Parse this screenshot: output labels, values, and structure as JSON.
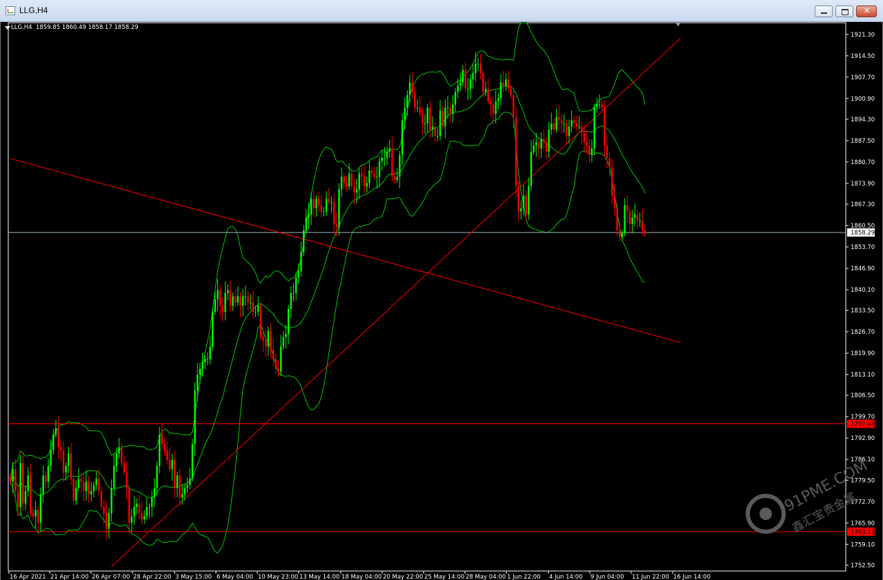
{
  "window": {
    "title": "LLG,H4"
  },
  "chart_header": {
    "symbol": "LLG,H4",
    "ohlc": "1859.85 1860.49 1858.17 1858.29"
  },
  "watermark": {
    "url": "91PME.COM",
    "brand": "鑫汇宝贵金属"
  },
  "colors": {
    "background": "#000000",
    "bull": "#00ff00",
    "bear": "#ff0000",
    "bands": "#00c800",
    "trendline": "#ff0000",
    "price_line": "#9fb6c6",
    "axis_text": "#ffffff",
    "marker_price_bg": "#ff0000"
  },
  "chart_data": {
    "type": "candlestick",
    "symbol": "LLG",
    "timeframe": "H4",
    "ylim": [
      1750.6,
      1925.0
    ],
    "y_ticks": [
      "1921.30",
      "1914.50",
      "1907.70",
      "1900.90",
      "1894.30",
      "1887.50",
      "1880.70",
      "1873.90",
      "1867.30",
      "1860.50",
      "1853.70",
      "1846.90",
      "1840.10",
      "1833.50",
      "1826.70",
      "1819.90",
      "1813.10",
      "1806.50",
      "1799.70",
      "1792.90",
      "1786.10",
      "1779.50",
      "1772.70",
      "1765.90",
      "1759.10",
      "1752.50"
    ],
    "x_ticks": [
      "16 Apr 2021",
      "21 Apr 14:00",
      "26 Apr 07:00",
      "28 Apr 22:00",
      "3 May 15:00",
      "6 May 04:00",
      "10 May 23:00",
      "13 May 14:00",
      "18 May 04:00",
      "20 May 22:00",
      "25 May 14:00",
      "28 May 04:00",
      "1 Jun 22:00",
      "4 Jun 14:00",
      "9 Jun 04:00",
      "11 Jun 22:00",
      "16 Jun 14:00"
    ],
    "current_price": "1858.29",
    "horizontal_levels": [
      "1797.44",
      "1763.13"
    ],
    "trendlines": [
      {
        "from": {
          "bar": 0,
          "price": 1881.8
        },
        "to": {
          "bar": 265,
          "price": 1823.3
        }
      },
      {
        "from": {
          "bar": 40,
          "price": 1752.0
        },
        "to": {
          "bar": 265,
          "price": 1920.0
        }
      }
    ],
    "series": {
      "close": [
        1779,
        1783,
        1776,
        1771,
        1785,
        1772,
        1776,
        1781,
        1769,
        1768,
        1770,
        1766,
        1775,
        1781,
        1779,
        1784,
        1789,
        1794,
        1796,
        1790,
        1789,
        1782,
        1784,
        1788,
        1780,
        1773,
        1777,
        1780,
        1779,
        1776,
        1779,
        1775,
        1776,
        1778,
        1780,
        1776,
        1771,
        1769,
        1764,
        1769,
        1777,
        1784,
        1788,
        1790,
        1785,
        1782,
        1777,
        1766,
        1768,
        1771,
        1772,
        1769,
        1767,
        1768,
        1771,
        1771,
        1774,
        1777,
        1784,
        1794,
        1791,
        1789,
        1786,
        1783,
        1786,
        1777,
        1781,
        1774,
        1775,
        1777,
        1778,
        1780,
        1791,
        1808,
        1813,
        1815,
        1817,
        1818,
        1818,
        1822,
        1833,
        1837,
        1840,
        1835,
        1833,
        1839,
        1840,
        1835,
        1838,
        1836,
        1838,
        1835,
        1838,
        1838,
        1836,
        1836,
        1833,
        1833,
        1835,
        1825,
        1824,
        1822,
        1827,
        1821,
        1818,
        1815,
        1814,
        1822,
        1825,
        1826,
        1834,
        1839,
        1839,
        1844,
        1846,
        1852,
        1859,
        1863,
        1864,
        1869,
        1866,
        1869,
        1867,
        1865,
        1865,
        1869,
        1868,
        1868,
        1861,
        1860,
        1872,
        1876,
        1874,
        1873,
        1877,
        1873,
        1871,
        1872,
        1877,
        1876,
        1873,
        1874,
        1878,
        1877,
        1876,
        1876,
        1881,
        1882,
        1882,
        1884,
        1885,
        1876,
        1875,
        1876,
        1883,
        1894,
        1898,
        1902,
        1906,
        1903,
        1898,
        1898,
        1896,
        1893,
        1893,
        1898,
        1891,
        1892,
        1889,
        1889,
        1897,
        1892,
        1898,
        1898,
        1896,
        1899,
        1903,
        1905,
        1906,
        1910,
        1904,
        1904,
        1907,
        1909,
        1912,
        1912,
        1909,
        1903,
        1904,
        1900,
        1899,
        1896,
        1900,
        1901,
        1906,
        1905,
        1907,
        1904,
        1902,
        1895,
        1873,
        1865,
        1866,
        1870,
        1864,
        1873,
        1884,
        1886,
        1887,
        1885,
        1888,
        1887,
        1884,
        1891,
        1893,
        1891,
        1895,
        1894,
        1893,
        1893,
        1889,
        1892,
        1894,
        1893,
        1892,
        1892,
        1890,
        1887,
        1886,
        1883,
        1885,
        1898,
        1899,
        1899,
        1898,
        1886,
        1882,
        1879,
        1870,
        1866,
        1859,
        1857,
        1858,
        1867,
        1865,
        1861,
        1863,
        1864,
        1862,
        1862,
        1859,
        1858
      ]
    },
    "indicators": [
      "Bollinger Bands (20)"
    ],
    "grid": false,
    "legend": "none"
  }
}
